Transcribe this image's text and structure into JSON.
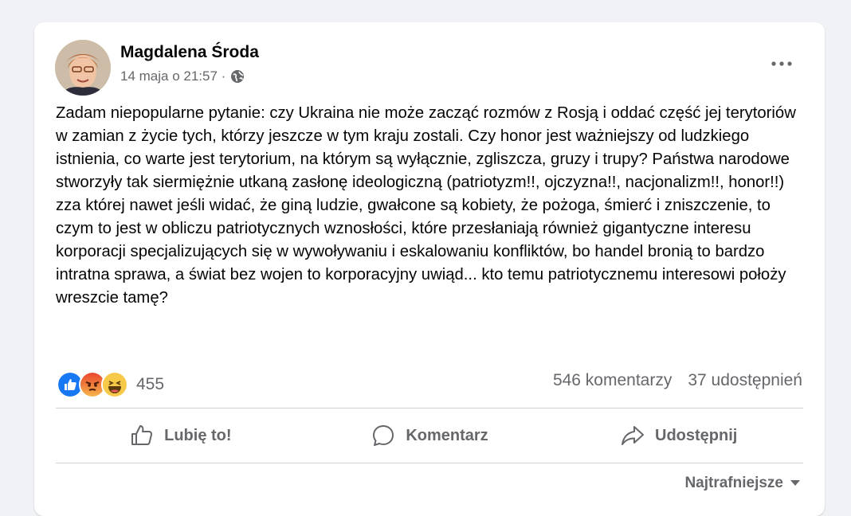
{
  "post": {
    "author": "Magdalena Środa",
    "date": "14 maja o 21:57 ·",
    "privacy_icon": "globe-icon",
    "more_icon": "more-options-icon",
    "text": "Zadam niepopularne pytanie: czy Ukraina nie może zacząć rozmów z Rosją i oddać część jej terytoriów w zamian z życie tych, którzy jeszcze w tym kraju zostali. Czy honor jest ważniejszy od ludzkiego istnienia, co warte jest terytorium, na którym są wyłącznie, zgliszcza, gruzy i trupy? Państwa narodowe stworzyły tak siermiężnie utkaną zasłonę ideologiczną (patriotyzm!!, ojczyzna!!, nacjonalizm!!, honor!!) zza której nawet jeśli widać, że giną ludzie, gwałcone są kobiety, że pożoga, śmierć i zniszczenie, to czym to jest w obliczu patriotycznych wznosłości, które przesłaniają również gigantyczne interesu korporacji specjalizujących się w wywoływaniu i eskalowaniu konfliktów, bo handel bronią to bardzo intratna sprawa, a świat bez wojen to korporacyjny uwiąd... kto temu patriotycznemu interesowi położy wreszcie tamę?"
  },
  "reactions": {
    "icons": [
      "like-icon",
      "angry-icon",
      "haha-icon"
    ],
    "count": "455"
  },
  "stats": {
    "comments": "546 komentarzy",
    "shares": "37 udostępnień"
  },
  "actions": {
    "like": "Lubię to!",
    "comment": "Komentarz",
    "share": "Udostępnij"
  },
  "sort": {
    "label": "Najtrafniejsze"
  },
  "colors": {
    "background": "#f0f2f5",
    "card": "#ffffff",
    "secondary_text": "#65676b",
    "like_blue": "#1877f2",
    "angry_red": "#f0533d",
    "haha_yellow": "#f7c948"
  }
}
